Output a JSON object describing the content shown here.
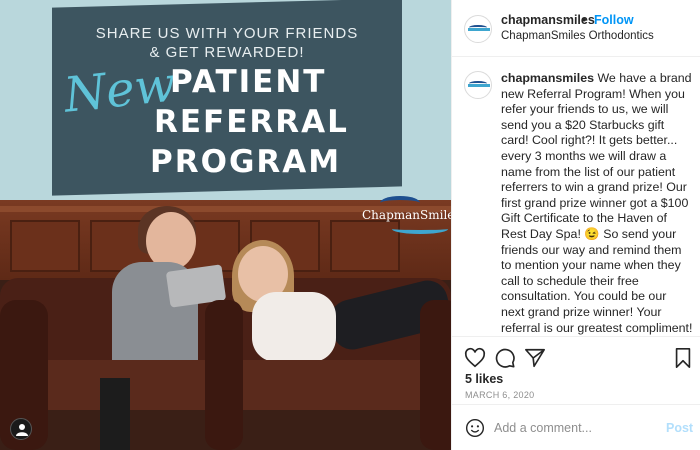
{
  "post_image": {
    "banner_share_line1": "SHARE US WITH YOUR FRIENDS",
    "banner_share_line2": "& GET REWARDED!",
    "banner_new": "New",
    "banner_title_line1": "PATIENT",
    "banner_title_line2": "REFERRAL",
    "banner_title_line3": "PROGRAM",
    "logo_text": "ChapmanSmiles"
  },
  "header": {
    "username": "chapmansmiles",
    "separator": "•",
    "follow_label": "Follow",
    "subtitle": "ChapmanSmiles Orthodontics"
  },
  "caption": {
    "username": "chapmansmiles",
    "text": "We have a brand new Referral Program! When you refer your friends to us, we will send you a $20 Starbucks gift card! Cool right?! It gets better... every 3 months we will draw a name from the list of our patient referrers to win a grand prize! Our first grand prize winner got a $100 Gift Certificate to the Haven of Rest Day Spa! 😉 So send your friends our way and remind them to mention your name when they call to schedule their free consultation. You could be our next grand prize winner! Your referral is our greatest compliment! 🤩",
    "dots": [
      ".",
      ".",
      ".",
      ".",
      "."
    ]
  },
  "actions": {
    "likes": "5 likes",
    "date": "MARCH 6, 2020",
    "icons": [
      "heart-icon",
      "comment-icon",
      "share-icon",
      "bookmark-icon"
    ]
  },
  "comment_bar": {
    "placeholder": "Add a comment...",
    "post_label": "Post"
  },
  "colors": {
    "accent_blue": "#0095f6",
    "post_disabled": "#b2dffc",
    "banner_bg": "#3d5560",
    "banner_new": "#5fc3d8"
  }
}
